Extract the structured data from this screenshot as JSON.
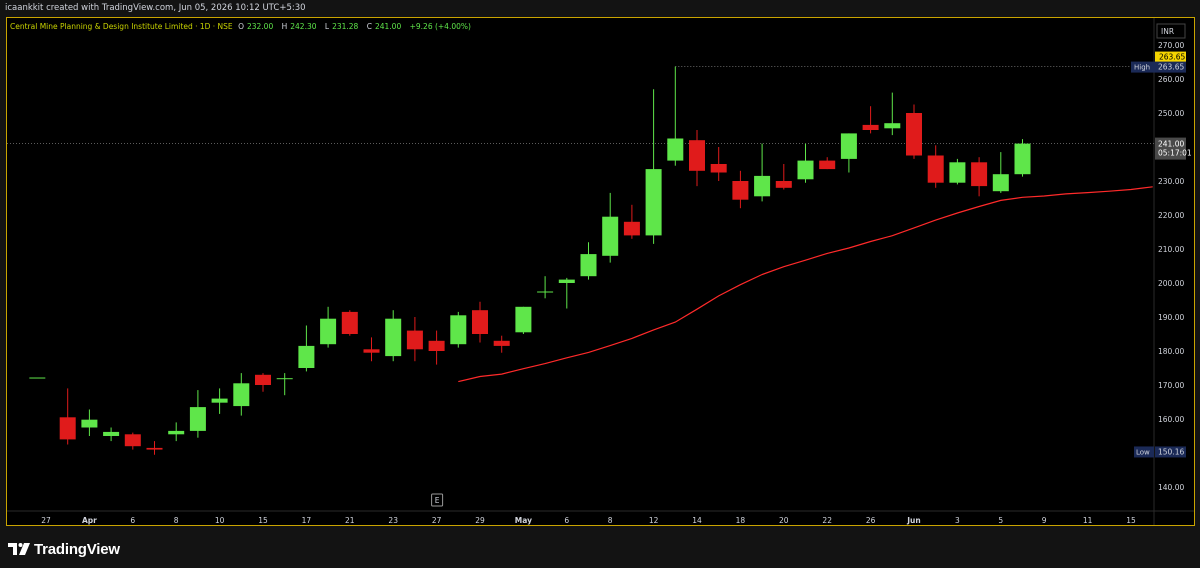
{
  "header": {
    "credit": "icaankkit created with TradingView.com, Jun 05, 2026 10:12 UTC+5:30"
  },
  "legend": {
    "symbol": "Central Mine Planning & Design Institute Limited · 1D · NSE",
    "open_label": "O",
    "open": "232.00",
    "high_label": "H",
    "high": "242.30",
    "low_label": "L",
    "low": "231.28",
    "close_label": "C",
    "close": "241.00",
    "change": "+9.26 (+4.00%)"
  },
  "colors": {
    "up": "#5fe64a",
    "down": "#e01b1b",
    "ma": "#ff2a2a",
    "high_badge": "#1b2a57",
    "price_badge": "#4a4a4a",
    "high_value_badge": "#f5d400",
    "border": "#c9a400"
  },
  "brand": {
    "name": "TradingView",
    "icon": "tradingview-logo-icon"
  },
  "chart_data": {
    "type": "candlestick",
    "currency": "INR",
    "ylim": [
      135,
      275
    ],
    "y_ticks": [
      270,
      260,
      250,
      240,
      230,
      220,
      210,
      200,
      190,
      180,
      170,
      160,
      150,
      140
    ],
    "x_ticks": [
      {
        "label": "27",
        "bar": 0,
        "bold": false
      },
      {
        "label": "Apr",
        "bar": 1,
        "bold": true
      },
      {
        "label": "6",
        "bar": 2,
        "bold": false
      },
      {
        "label": "8",
        "bar": 3,
        "bold": false
      },
      {
        "label": "10",
        "bar": 4,
        "bold": false
      },
      {
        "label": "15",
        "bar": 5,
        "bold": false
      },
      {
        "label": "17",
        "bar": 6,
        "bold": false
      },
      {
        "label": "21",
        "bar": 7,
        "bold": false
      },
      {
        "label": "23",
        "bar": 8,
        "bold": false
      },
      {
        "label": "27",
        "bar": 9,
        "bold": false
      },
      {
        "label": "29",
        "bar": 10,
        "bold": false
      },
      {
        "label": "May",
        "bar": 11,
        "bold": true
      },
      {
        "label": "6",
        "bar": 12,
        "bold": false
      },
      {
        "label": "8",
        "bar": 13,
        "bold": false
      },
      {
        "label": "12",
        "bar": 14,
        "bold": false
      },
      {
        "label": "14",
        "bar": 15,
        "bold": false
      },
      {
        "label": "18",
        "bar": 16,
        "bold": false
      },
      {
        "label": "20",
        "bar": 17,
        "bold": false
      },
      {
        "label": "22",
        "bar": 18,
        "bold": false
      },
      {
        "label": "26",
        "bar": 19,
        "bold": false
      },
      {
        "label": "Jun",
        "bar": 20,
        "bold": true
      },
      {
        "label": "3",
        "bar": 21,
        "bold": false
      },
      {
        "label": "5",
        "bar": 22,
        "bold": false
      },
      {
        "label": "9",
        "bar": 23,
        "bold": false
      },
      {
        "label": "11",
        "bar": 24,
        "bold": false
      },
      {
        "label": "15",
        "bar": 25,
        "bold": false
      }
    ],
    "candles": [
      {
        "o": 172.2,
        "h": 172.2,
        "l": 172.2,
        "c": 172.2
      },
      {
        "o": 160.5,
        "h": 169.0,
        "l": 152.5,
        "c": 154.0
      },
      {
        "o": 157.5,
        "h": 162.8,
        "l": 155.0,
        "c": 159.8
      },
      {
        "o": 155.0,
        "h": 157.5,
        "l": 153.5,
        "c": 156.2
      },
      {
        "o": 155.5,
        "h": 156.0,
        "l": 151.0,
        "c": 152.0
      },
      {
        "o": 151.5,
        "h": 153.5,
        "l": 149.5,
        "c": 151.0
      },
      {
        "o": 155.5,
        "h": 159.0,
        "l": 153.5,
        "c": 156.5
      },
      {
        "o": 156.5,
        "h": 168.5,
        "l": 154.5,
        "c": 163.5
      },
      {
        "o": 164.8,
        "h": 169.0,
        "l": 161.5,
        "c": 166.0
      },
      {
        "o": 163.8,
        "h": 173.5,
        "l": 161.0,
        "c": 170.5
      },
      {
        "o": 173.0,
        "h": 173.5,
        "l": 168.0,
        "c": 170.0
      },
      {
        "o": 172.0,
        "h": 173.5,
        "l": 167.0,
        "c": 172.0
      },
      {
        "o": 175.0,
        "h": 187.5,
        "l": 174.0,
        "c": 181.5
      },
      {
        "o": 182.0,
        "h": 193.0,
        "l": 181.0,
        "c": 189.5
      },
      {
        "o": 191.5,
        "h": 192.0,
        "l": 184.5,
        "c": 185.0
      },
      {
        "o": 180.5,
        "h": 184.0,
        "l": 177.0,
        "c": 179.5
      },
      {
        "o": 178.5,
        "h": 192.0,
        "l": 177.0,
        "c": 189.5
      },
      {
        "o": 186.0,
        "h": 190.0,
        "l": 177.0,
        "c": 180.5
      },
      {
        "o": 183.0,
        "h": 186.0,
        "l": 176.0,
        "c": 180.0
      },
      {
        "o": 182.0,
        "h": 191.5,
        "l": 181.0,
        "c": 190.5
      },
      {
        "o": 192.0,
        "h": 194.5,
        "l": 182.5,
        "c": 185.0
      },
      {
        "o": 183.0,
        "h": 184.5,
        "l": 179.5,
        "c": 181.5
      },
      {
        "o": 185.5,
        "h": 193.0,
        "l": 185.0,
        "c": 193.0
      },
      {
        "o": 197.5,
        "h": 202.0,
        "l": 195.5,
        "c": 197.5
      },
      {
        "o": 200.0,
        "h": 201.5,
        "l": 192.5,
        "c": 201.0
      },
      {
        "o": 202.0,
        "h": 212.0,
        "l": 201.0,
        "c": 208.5
      },
      {
        "o": 208.0,
        "h": 226.5,
        "l": 206.0,
        "c": 219.5
      },
      {
        "o": 218.0,
        "h": 223.0,
        "l": 213.0,
        "c": 214.0
      },
      {
        "o": 214.0,
        "h": 257.0,
        "l": 211.5,
        "c": 233.5
      },
      {
        "o": 236.0,
        "h": 263.65,
        "l": 234.5,
        "c": 242.5
      },
      {
        "o": 242.0,
        "h": 245.0,
        "l": 228.5,
        "c": 233.0
      },
      {
        "o": 235.0,
        "h": 240.0,
        "l": 230.0,
        "c": 232.5
      },
      {
        "o": 230.0,
        "h": 233.0,
        "l": 222.0,
        "c": 224.5
      },
      {
        "o": 225.5,
        "h": 241.0,
        "l": 224.0,
        "c": 231.5
      },
      {
        "o": 230.0,
        "h": 235.0,
        "l": 227.5,
        "c": 228.0
      },
      {
        "o": 230.5,
        "h": 241.0,
        "l": 229.5,
        "c": 236.0
      },
      {
        "o": 236.0,
        "h": 237.0,
        "l": 233.5,
        "c": 233.5
      },
      {
        "o": 236.5,
        "h": 244.0,
        "l": 232.5,
        "c": 244.0
      },
      {
        "o": 246.5,
        "h": 252.0,
        "l": 244.0,
        "c": 245.0
      },
      {
        "o": 245.5,
        "h": 256.0,
        "l": 243.5,
        "c": 247.0
      },
      {
        "o": 250.0,
        "h": 252.5,
        "l": 236.5,
        "c": 237.5
      },
      {
        "o": 237.5,
        "h": 240.5,
        "l": 228.0,
        "c": 229.5
      },
      {
        "o": 229.5,
        "h": 236.5,
        "l": 229.0,
        "c": 235.5
      },
      {
        "o": 235.5,
        "h": 237.0,
        "l": 225.5,
        "c": 228.5
      },
      {
        "o": 227.0,
        "h": 238.5,
        "l": 226.5,
        "c": 232.0
      },
      {
        "o": 232.0,
        "h": 242.3,
        "l": 231.28,
        "c": 241.0
      }
    ],
    "candle_bar_positions": [
      -0.2,
      0.5,
      1.0,
      1.5,
      2.0,
      2.5,
      3.0,
      3.5,
      4.0,
      4.5,
      5.0,
      5.5,
      6.0,
      6.5,
      7.0,
      7.5,
      8.0,
      8.5,
      9.0,
      9.5,
      10.0,
      10.5,
      11.0,
      11.5,
      12.0,
      12.5,
      13.0,
      13.5,
      14.0,
      14.5,
      15.0,
      15.5,
      16.0,
      16.5,
      17.0,
      17.5,
      18.0,
      18.5,
      19.0,
      19.5,
      20.0,
      20.5,
      21.0,
      21.5,
      22.0,
      22.5
    ],
    "moving_average": [
      {
        "bar": 9.5,
        "value": 171.0
      },
      {
        "bar": 10.0,
        "value": 172.5
      },
      {
        "bar": 10.5,
        "value": 173.2
      },
      {
        "bar": 11.0,
        "value": 174.8
      },
      {
        "bar": 11.5,
        "value": 176.3
      },
      {
        "bar": 12.0,
        "value": 178.0
      },
      {
        "bar": 12.5,
        "value": 179.6
      },
      {
        "bar": 13.0,
        "value": 181.6
      },
      {
        "bar": 13.5,
        "value": 183.7
      },
      {
        "bar": 14.0,
        "value": 186.2
      },
      {
        "bar": 14.5,
        "value": 188.5
      },
      {
        "bar": 15.0,
        "value": 192.3
      },
      {
        "bar": 15.5,
        "value": 196.2
      },
      {
        "bar": 16.0,
        "value": 199.5
      },
      {
        "bar": 16.5,
        "value": 202.5
      },
      {
        "bar": 17.0,
        "value": 204.8
      },
      {
        "bar": 17.5,
        "value": 206.7
      },
      {
        "bar": 18.0,
        "value": 208.7
      },
      {
        "bar": 18.5,
        "value": 210.3
      },
      {
        "bar": 19.0,
        "value": 212.2
      },
      {
        "bar": 19.5,
        "value": 213.9
      },
      {
        "bar": 20.0,
        "value": 216.2
      },
      {
        "bar": 20.5,
        "value": 218.5
      },
      {
        "bar": 21.0,
        "value": 220.6
      },
      {
        "bar": 21.5,
        "value": 222.5
      },
      {
        "bar": 22.0,
        "value": 224.3
      },
      {
        "bar": 22.5,
        "value": 225.2
      },
      {
        "bar": 23.0,
        "value": 225.6
      },
      {
        "bar": 23.5,
        "value": 226.2
      },
      {
        "bar": 24.0,
        "value": 226.6
      },
      {
        "bar": 24.5,
        "value": 227.0
      },
      {
        "bar": 25.0,
        "value": 227.5
      },
      {
        "bar": 25.5,
        "value": 228.3
      }
    ],
    "high_marker": {
      "label": "High",
      "value": 263.65,
      "display": "263.65"
    },
    "high_value_badge": "263.65",
    "low_marker": {
      "label": "Low",
      "value": 150.16,
      "display": "150.16"
    },
    "last_price": {
      "display": "241.00",
      "countdown": "05:17:01",
      "value": 241.0
    },
    "event_marker": {
      "label": "E",
      "bar": 9.0
    }
  }
}
